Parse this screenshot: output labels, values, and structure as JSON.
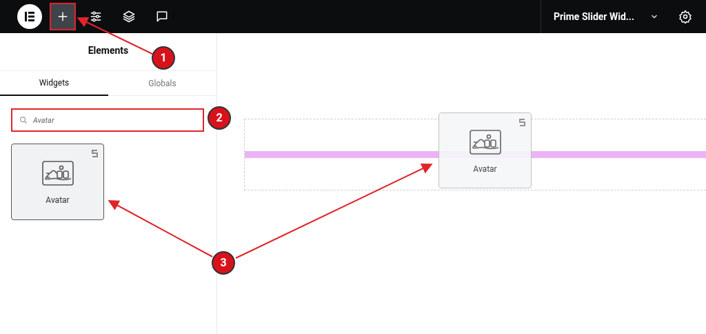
{
  "topbar": {
    "tools": [
      {
        "kind": "add",
        "selected": true
      },
      {
        "kind": "settings",
        "selected": false
      },
      {
        "kind": "layers",
        "selected": false
      },
      {
        "kind": "comments",
        "selected": false
      }
    ],
    "page_title": "Prime Slider Wid..."
  },
  "panel": {
    "title": "Elements",
    "tabs": [
      {
        "label": "Widgets",
        "selected": true
      },
      {
        "label": "Globals",
        "selected": false
      }
    ],
    "search": {
      "value": "Avatar"
    },
    "widgets": [
      {
        "label": "Avatar"
      }
    ]
  },
  "canvas": {
    "drag_widget": {
      "label": "Avatar"
    }
  },
  "callouts": [
    "1",
    "2",
    "3"
  ]
}
